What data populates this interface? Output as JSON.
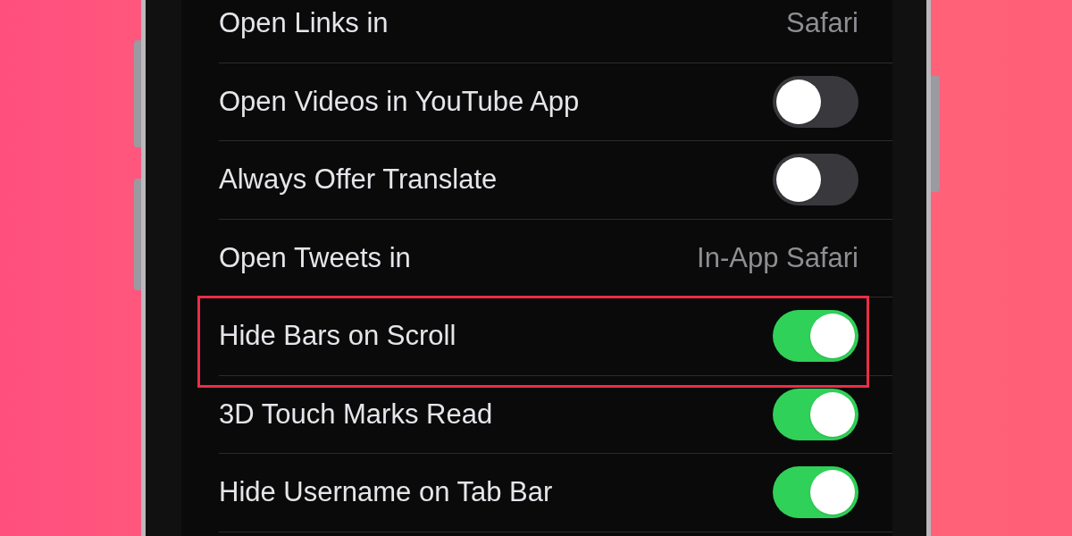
{
  "settings": [
    {
      "kind": "value",
      "label": "Open Links in",
      "value": "Safari",
      "highlighted": false
    },
    {
      "kind": "toggle",
      "label": "Open Videos in YouTube App",
      "on": false,
      "highlighted": false
    },
    {
      "kind": "toggle",
      "label": "Always Offer Translate",
      "on": false,
      "highlighted": false
    },
    {
      "kind": "value",
      "label": "Open Tweets in",
      "value": "In-App Safari",
      "highlighted": false
    },
    {
      "kind": "toggle",
      "label": "Hide Bars on Scroll",
      "on": true,
      "highlighted": true
    },
    {
      "kind": "toggle",
      "label": "3D Touch Marks Read",
      "on": true,
      "highlighted": false
    },
    {
      "kind": "toggle",
      "label": "Hide Username on Tab Bar",
      "on": true,
      "highlighted": false
    }
  ]
}
